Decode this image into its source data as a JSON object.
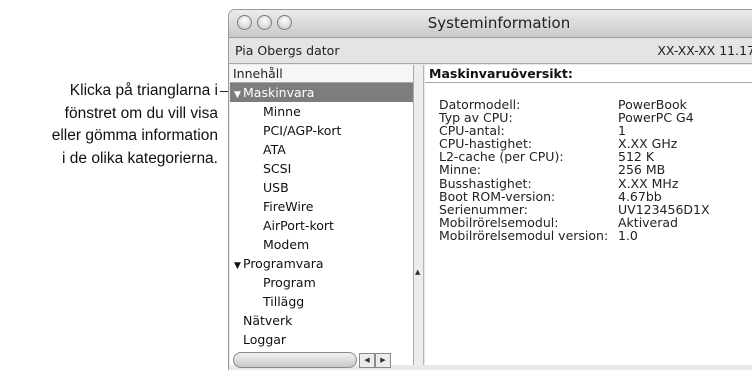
{
  "callout": {
    "lines": [
      "Klicka på trianglarna i",
      "fönstret om du vill visa",
      "eller gömma information",
      "i de olika kategorierna."
    ]
  },
  "window": {
    "title": "Systeminformation",
    "computer_name": "Pia Obergs dator",
    "date_version": "XX-XX-XX 11.17"
  },
  "sidebar": {
    "header": "Innehåll",
    "hardware": "Maskinvara",
    "hardware_items": [
      "Minne",
      "PCI/AGP-kort",
      "ATA",
      "SCSI",
      "USB",
      "FireWire",
      "AirPort-kort",
      "Modem"
    ],
    "software": "Programvara",
    "software_items": [
      "Program",
      "Tillägg"
    ],
    "network": "Nätverk",
    "logs": "Loggar"
  },
  "content": {
    "header": "Maskinvaruöversikt:",
    "rows": [
      {
        "label": "Datormodell:",
        "value": "PowerBook"
      },
      {
        "label": "Typ av CPU:",
        "value": "PowerPC G4"
      },
      {
        "label": "CPU-antal:",
        "value": "1"
      },
      {
        "label": "CPU-hastighet:",
        "value": "X.XX GHz"
      },
      {
        "label": "L2-cache (per CPU):",
        "value": "512 K"
      },
      {
        "label": "Minne:",
        "value": "256 MB"
      },
      {
        "label": "Busshastighet:",
        "value": "X.XX MHz"
      },
      {
        "label": "Boot ROM-version:",
        "value": "4.67bb"
      },
      {
        "label": "Serienummer:",
        "value": "UV123456D1X"
      },
      {
        "label": "Mobilrörelsemodul:",
        "value": "Aktiverad"
      },
      {
        "label": "Mobilrörelsemodul version:",
        "value": "1.0"
      }
    ]
  },
  "icons": {
    "disclosure_open": "▼",
    "scroll_up": "▲",
    "arrow_left": "◀",
    "arrow_right": "▶"
  }
}
